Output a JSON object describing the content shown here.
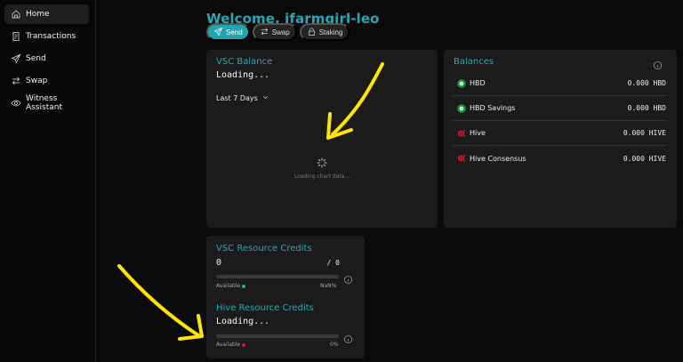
{
  "sidebar": {
    "items": [
      {
        "label": "Home",
        "icon": "home-icon",
        "active": true
      },
      {
        "label": "Transactions",
        "icon": "receipt-icon",
        "active": false
      },
      {
        "label": "Send",
        "icon": "send-icon",
        "active": false
      },
      {
        "label": "Swap",
        "icon": "swap-icon",
        "active": false
      },
      {
        "label": "Witness Assistant",
        "icon": "eye-icon",
        "active": false
      }
    ]
  },
  "header": {
    "welcome": "Welcome, ifarmgirl-leo",
    "actions": [
      {
        "label": "Send",
        "icon": "send-icon",
        "active": true
      },
      {
        "label": "Swap",
        "icon": "swap-icon",
        "active": false
      },
      {
        "label": "Staking",
        "icon": "lock-icon",
        "active": false
      }
    ]
  },
  "vsc_balance": {
    "title": "VSC Balance",
    "status": "Loading...",
    "range": "Last 7 Days",
    "chart_status": "Loading chart data..."
  },
  "balances": {
    "title": "Balances",
    "items": [
      {
        "name": "HBD",
        "amount": "0.000 HBD",
        "icon": "hbd-icon"
      },
      {
        "name": "HBD Savings",
        "amount": "0.000 HBD",
        "icon": "hbd-icon"
      },
      {
        "name": "Hive",
        "amount": "0.000 HIVE",
        "icon": "hive-icon"
      },
      {
        "name": "Hive Consensus",
        "amount": "0.000 HIVE",
        "icon": "hive-icon"
      }
    ]
  },
  "resource_credits": {
    "vsc": {
      "title": "VSC Resource Credits",
      "value": "0",
      "max": "/ 0",
      "available_label": "Available",
      "percent": "NaN%",
      "bar_level": 0
    },
    "hive": {
      "title": "Hive Resource Credits",
      "value": "Loading...",
      "available_label": "Available",
      "percent": "0%",
      "bar_level": 0
    }
  },
  "colors": {
    "accent": "#25a7b6",
    "hbd": "#19a349",
    "hive": "#e31337",
    "arrow": "#ffe600"
  }
}
